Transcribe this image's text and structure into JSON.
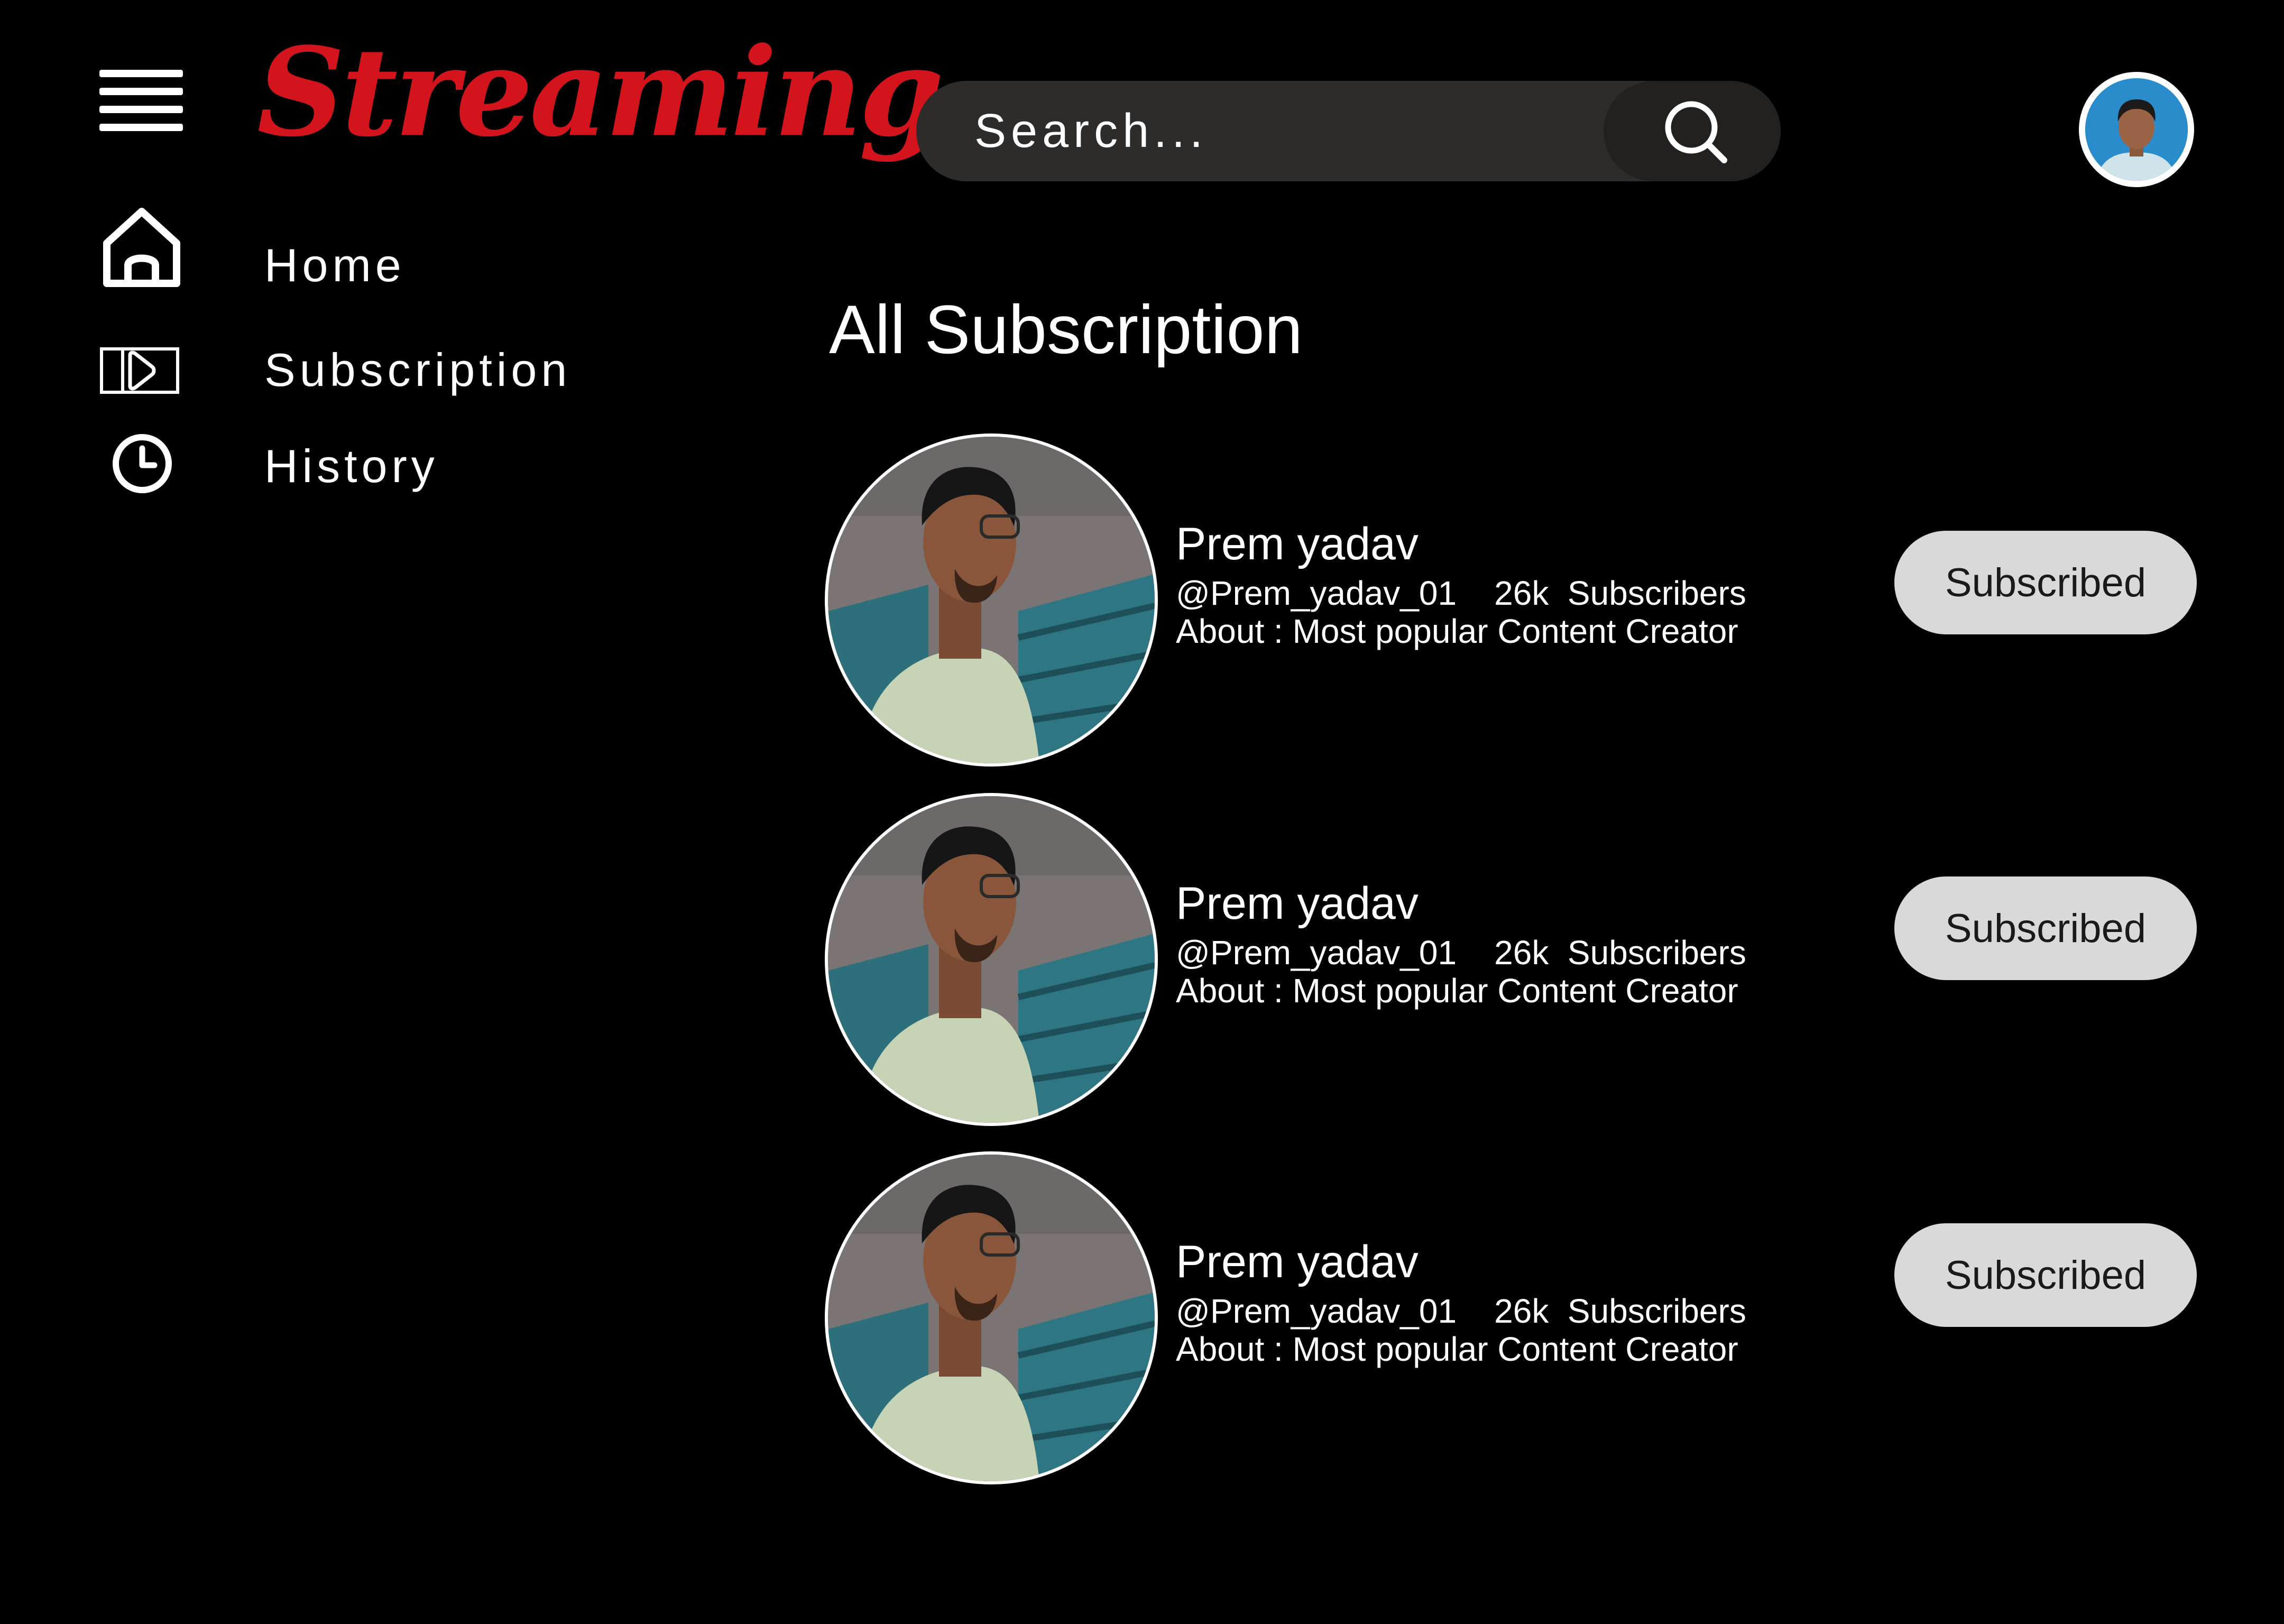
{
  "app": {
    "logo_text": "Streaming",
    "brand_color": "#d4141c"
  },
  "header": {
    "menu_icon": "hamburger-menu-icon",
    "search": {
      "placeholder": "Search...",
      "value": "",
      "icon": "search-icon"
    },
    "profile_avatar": "user-avatar"
  },
  "sidebar": {
    "items": [
      {
        "label": "Home",
        "icon": "home-icon"
      },
      {
        "label": "Subscription",
        "icon": "subscription-play-icon"
      },
      {
        "label": "History",
        "icon": "clock-icon"
      }
    ]
  },
  "main": {
    "title": "All Subscription",
    "subscriptions": [
      {
        "name": "Prem yadav",
        "handle": "@Prem_yadav_01",
        "subscribers": "26k  Subscribers",
        "about": "About : Most popular Content Creator",
        "button_label": "Subscribed"
      },
      {
        "name": "Prem yadav",
        "handle": "@Prem_yadav_01",
        "subscribers": "26k  Subscribers",
        "about": "About : Most popular Content Creator",
        "button_label": "Subscribed"
      },
      {
        "name": "Prem yadav",
        "handle": "@Prem_yadav_01",
        "subscribers": "26k  Subscribers",
        "about": "About : Most popular Content Creator",
        "button_label": "Subscribed"
      }
    ]
  },
  "colors": {
    "background": "#000000",
    "text": "#ffffff",
    "search_bg": "#2e2c2b",
    "button_bg": "#d9d9d9",
    "button_text": "#1a1a1a"
  }
}
